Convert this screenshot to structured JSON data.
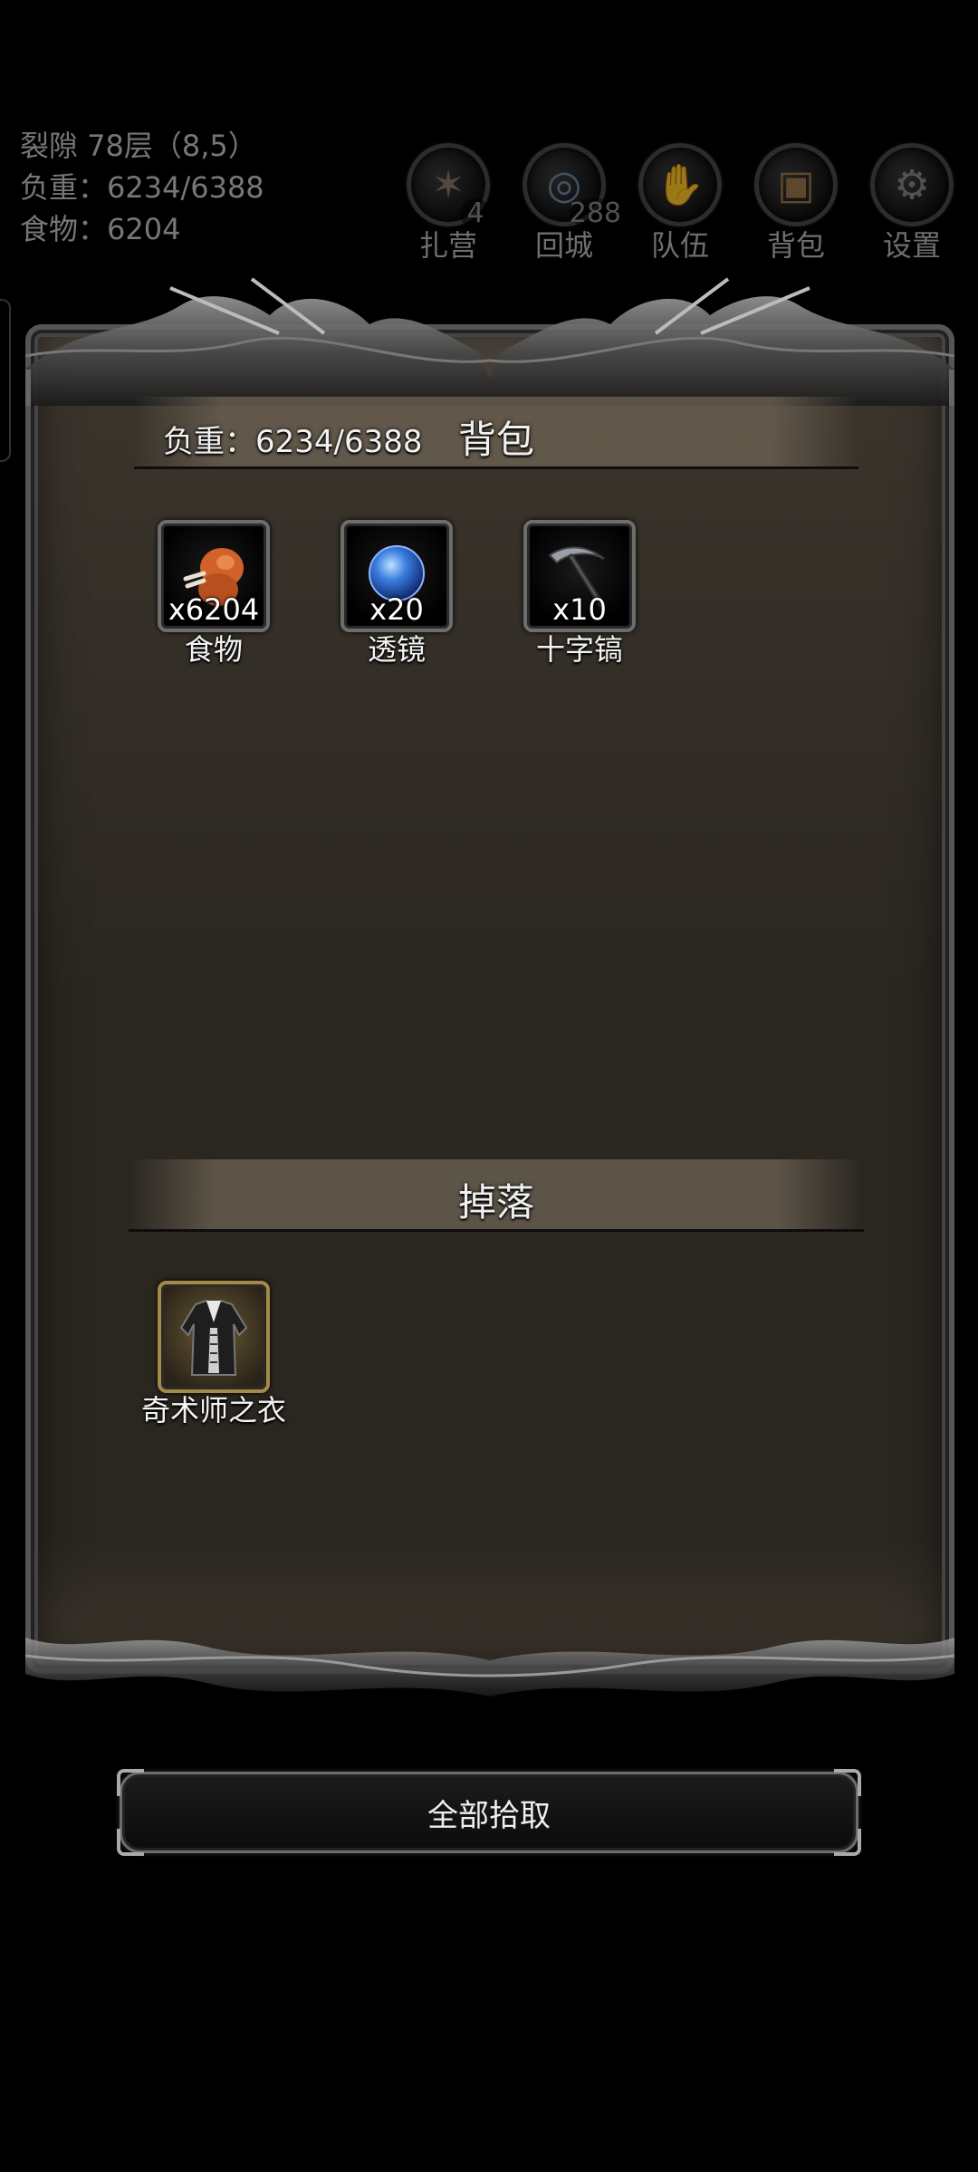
{
  "status": {
    "location": "裂隙 78层（8,5）",
    "weight": "负重：6234/6388",
    "food": "食物：6204"
  },
  "top_menu": [
    {
      "label": "扎营",
      "icon": "campfire-icon",
      "badge": "4"
    },
    {
      "label": "回城",
      "icon": "portal-icon",
      "badge": "288"
    },
    {
      "label": "队伍",
      "icon": "team-icon",
      "badge": ""
    },
    {
      "label": "背包",
      "icon": "backpack-icon",
      "badge": ""
    },
    {
      "label": "设置",
      "icon": "gear-icon",
      "badge": ""
    }
  ],
  "bag": {
    "title": "背包",
    "weight": "负重：6234/6388",
    "items": [
      {
        "name": "食物",
        "qty": "x6204",
        "icon": "meat-icon"
      },
      {
        "name": "透镜",
        "qty": "x20",
        "icon": "lens-icon"
      },
      {
        "name": "十字镐",
        "qty": "x10",
        "icon": "pickaxe-icon"
      }
    ]
  },
  "drops": {
    "title": "掉落",
    "items": [
      {
        "name": "奇术师之衣",
        "qty": "",
        "icon": "robe-icon"
      }
    ]
  },
  "actions": {
    "pick_all": "全部拾取"
  },
  "colors": {
    "background": "#000000",
    "panel": "#2a2620",
    "header_band": "#6e6455",
    "text": "#f0f0f0",
    "dim_text": "#777777",
    "gold_slot": "#a58a45"
  }
}
